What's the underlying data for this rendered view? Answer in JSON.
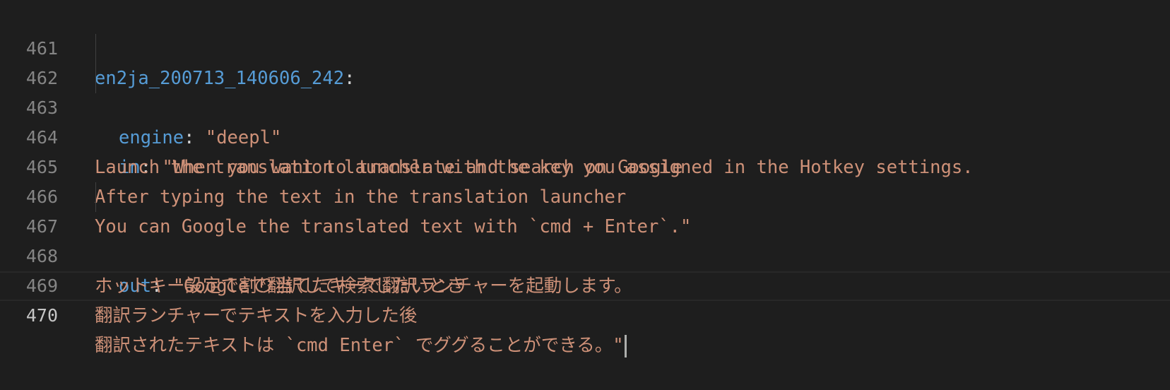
{
  "editor": {
    "lines": [
      {
        "number": "461",
        "key": "en2ja_200713_140606_242",
        "sep": ":"
      },
      {
        "number": "462",
        "key": "engine",
        "sep": ": ",
        "value": "\"deepl\""
      },
      {
        "number": "463",
        "key": "in",
        "sep": ": ",
        "value": "\"When you want to translate and search on Google"
      },
      {
        "number": "464",
        "text": "Launch the translation launcher with the key you assigned in the Hotkey settings."
      },
      {
        "number": "465",
        "text": "After typing the text in the translation launcher"
      },
      {
        "number": "466",
        "text": "You can Google the translated text with `cmd + Enter`.\""
      },
      {
        "number": "467",
        "key": "out",
        "sep": ": ",
        "value": "\"Googleで翻訳して検索したいとき"
      },
      {
        "number": "468",
        "text": "ホットキー設定で割り当てたキーで翻訳ランチャーを起動します。"
      },
      {
        "number": "469",
        "text": "翻訳ランチャーでテキストを入力した後"
      },
      {
        "number": "470",
        "text": "翻訳されたテキストは `cmd Enter` でググることができる。\""
      }
    ],
    "colors": {
      "background": "#1e1e1e",
      "key": "#569cd6",
      "string": "#ce9178",
      "punctuation": "#d4d4d4",
      "line_number": "#858585",
      "active_line_number": "#c6c6c6",
      "cursor": "#aeafad"
    }
  }
}
